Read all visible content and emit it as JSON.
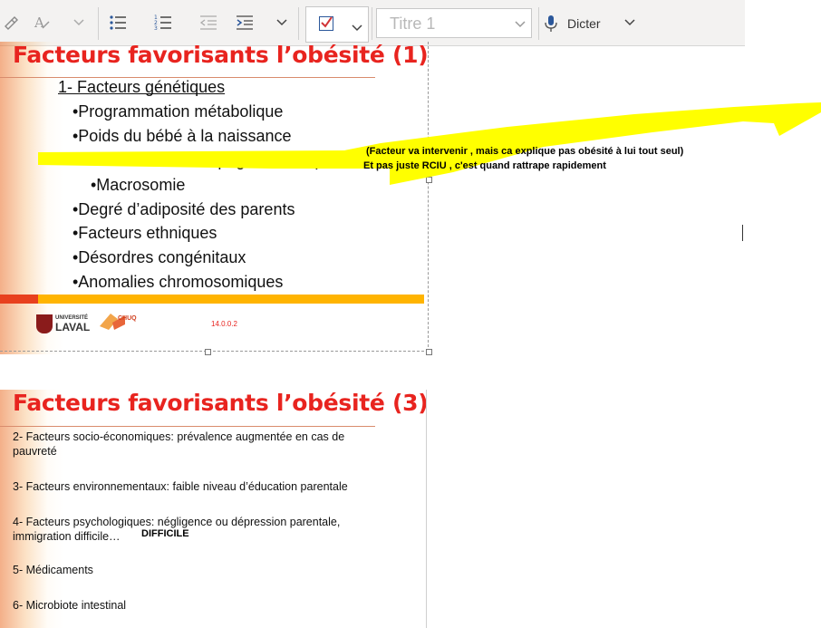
{
  "toolbar": {
    "style_placeholder": "Titre 1",
    "dictate_label": "Dicter"
  },
  "slide1": {
    "title": "Facteurs favorisants l’obésité (1)",
    "heading": "1- Facteurs génétiques",
    "bullets": [
      "•Programmation métabolique",
      "•Poids du bébé à la naissance",
      "•RCIU avec rattrapage initial rapide",
      "•Macrosomie",
      "•Degré d’adiposité des parents",
      "•Facteurs ethniques",
      "•Désordres congénitaux",
      "•Anomalies chromosomiques"
    ],
    "logo_text_1": "UNIVERSITÉ",
    "logo_text_2": "LAVAL",
    "logo_chuq": "CHUQ",
    "code": "14.0.0.2"
  },
  "annotations": {
    "note_1": "(Facteur va intervenir , mais ca explique pas obésité à lui tout seul)",
    "note_2": "Et pas juste RCIU , c'est quand rattrape rapidement",
    "note_3": "DIFFICILE"
  },
  "slide2": {
    "title": "Facteurs favorisants l’obésité (3)",
    "items": [
      "2- Facteurs socio-économiques: prévalence augmentée en cas de pauvreté",
      "3- Facteurs environnementaux: faible niveau d’éducation parentale",
      "4- Facteurs psychologiques: négligence ou dépression parentale, immigration difficile…",
      "5- Médicaments",
      "6- Microbiote intestinal"
    ]
  },
  "colors": {
    "title_red": "#e8241f",
    "highlight_yellow": "#ffff00",
    "band_orange": "#ffb400",
    "band_red": "#e8401e"
  }
}
